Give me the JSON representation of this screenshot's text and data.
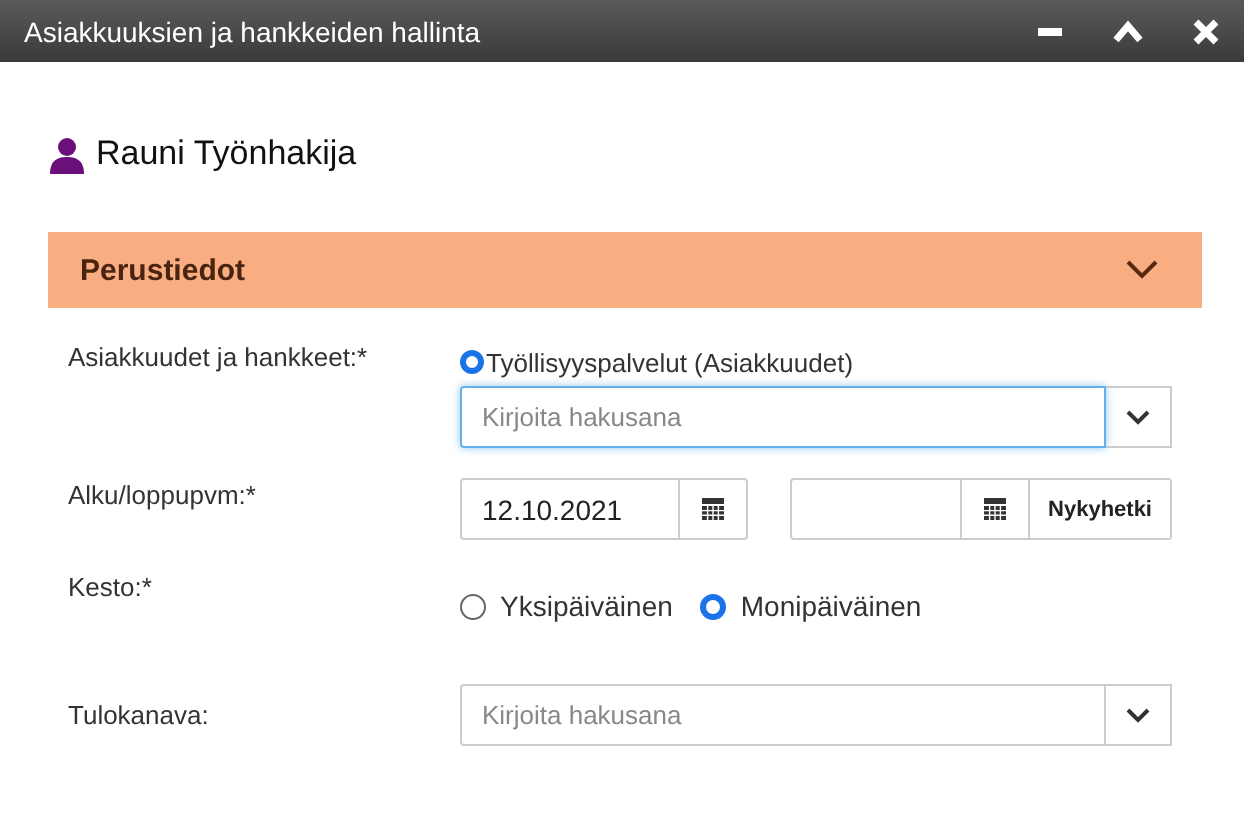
{
  "window": {
    "title": "Asiakkuuksien ja hankkeiden hallinta"
  },
  "user": {
    "name": "Rauni Työnhakija"
  },
  "section": {
    "title": "Perustiedot",
    "expanded": true
  },
  "fields": [
    {
      "kind": "combo",
      "label": "Asiakkuudet ja hankkeet:*",
      "options": [
        {
          "label": "Työllisyyspalvelut (Asiakkuudet)",
          "selected": true
        }
      ],
      "placeholder": "Kirjoita hakusana",
      "focused": true
    },
    {
      "kind": "dates",
      "label": "Alku/loppupvm:*",
      "start": "12.10.2021",
      "now_button": "Nykyhetki"
    },
    {
      "kind": "radios",
      "label": "Kesto:*",
      "options": [
        {
          "label": "Yksipäiväinen",
          "selected": false
        },
        {
          "label": "Monipäiväinen",
          "selected": true
        }
      ]
    },
    {
      "kind": "combo",
      "label": "Tulokanava:",
      "placeholder": "Kirjoita hakusana",
      "focused": false
    }
  ]
}
